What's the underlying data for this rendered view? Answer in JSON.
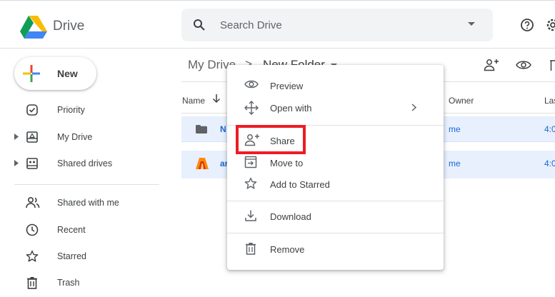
{
  "app": {
    "brand": "Drive"
  },
  "search": {
    "placeholder": "Search Drive"
  },
  "new_button": {
    "label": "New"
  },
  "sidebar": {
    "items": [
      {
        "label": "Priority",
        "icon": "priority-icon"
      },
      {
        "label": "My Drive",
        "icon": "my-drive-icon",
        "expandable": true
      },
      {
        "label": "Shared drives",
        "icon": "shared-drives-icon",
        "expandable": true
      },
      {
        "label": "Shared with me",
        "icon": "shared-with-me-icon"
      },
      {
        "label": "Recent",
        "icon": "clock-icon"
      },
      {
        "label": "Starred",
        "icon": "star-icon"
      },
      {
        "label": "Trash",
        "icon": "trash-icon"
      }
    ]
  },
  "breadcrumb": {
    "root": "My Drive",
    "separator": ">",
    "current": "New Folder"
  },
  "table": {
    "columns": {
      "name": "Name",
      "owner": "Owner",
      "last": "Las"
    },
    "rows": [
      {
        "name": "N",
        "owner": "me",
        "time": "4:0",
        "icon": "folder-icon"
      },
      {
        "name": "ar",
        "owner": "me",
        "time": "4:0",
        "icon": "app-file-icon"
      }
    ]
  },
  "context_menu": {
    "items": [
      {
        "label": "Preview",
        "icon": "eye-icon"
      },
      {
        "label": "Open with",
        "icon": "open-with-icon",
        "submenu": true
      },
      {
        "label": "Share",
        "icon": "add-person-icon",
        "highlighted": true
      },
      {
        "label": "Move to",
        "icon": "move-to-icon"
      },
      {
        "label": "Add to Starred",
        "icon": "star-icon"
      },
      {
        "label": "Download",
        "icon": "download-icon"
      },
      {
        "label": "Remove",
        "icon": "trash-icon"
      }
    ]
  },
  "colors": {
    "accent": "#1967d2",
    "selected_row": "#e8f0fe",
    "highlight_border": "#ee1c25",
    "text": "#3c4043",
    "icon": "#5f6368"
  }
}
